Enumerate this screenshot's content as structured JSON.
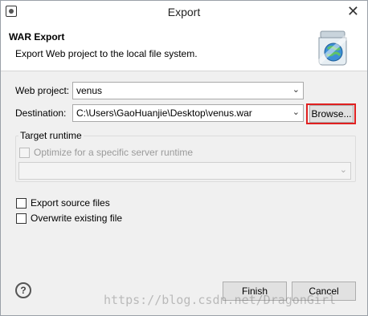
{
  "window": {
    "title": "Export",
    "close_glyph": "✕"
  },
  "banner": {
    "title": "WAR Export",
    "description": "Export Web project to the local file system."
  },
  "form": {
    "web_project_label": "Web project:",
    "web_project_value": "venus",
    "destination_label": "Destination:",
    "destination_value": "C:\\Users\\GaoHuanjie\\Desktop\\venus.war",
    "browse_label": "Browse..."
  },
  "target_runtime": {
    "group_label": "Target runtime",
    "optimize_label": "Optimize for a specific server runtime",
    "runtime_value": ""
  },
  "options": {
    "export_source_label": "Export source files",
    "overwrite_label": "Overwrite existing file"
  },
  "footer": {
    "help_glyph": "?",
    "finish_label": "Finish",
    "cancel_label": "Cancel"
  },
  "watermark": "https://blog.csdn.net/DragonGirl",
  "colors": {
    "highlight": "#e02020",
    "accent": "#3c8fd6"
  }
}
